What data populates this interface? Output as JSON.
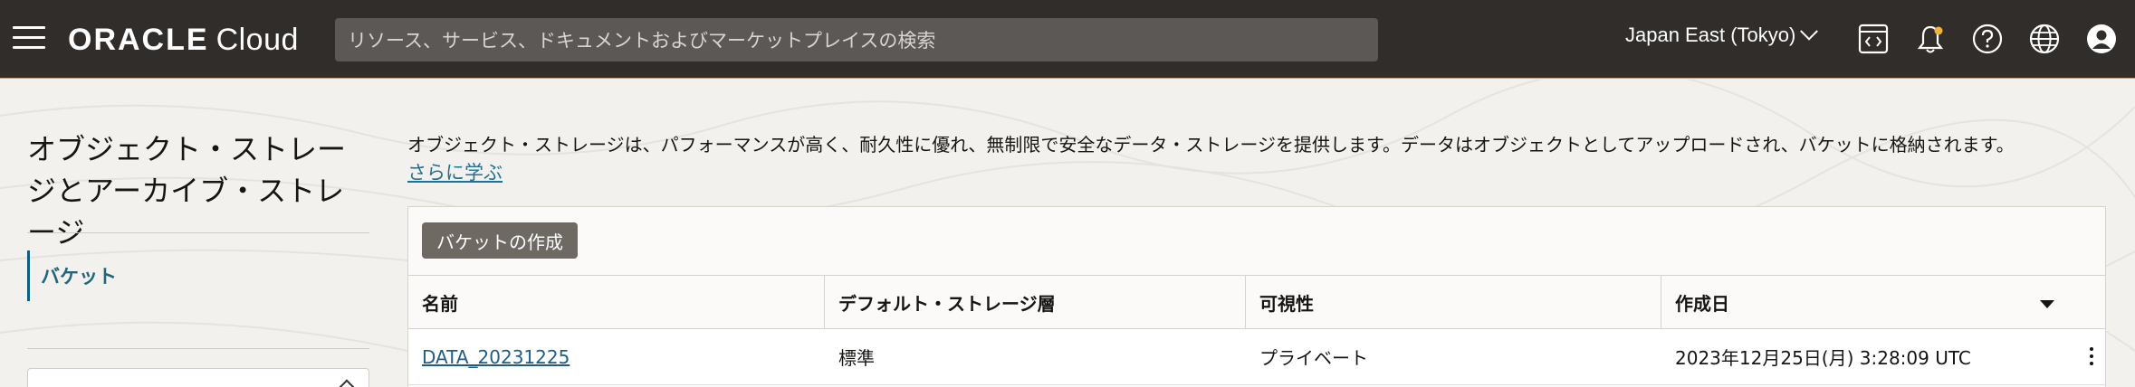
{
  "header": {
    "brand_main": "ORACLE",
    "brand_sub": "Cloud",
    "search_placeholder": "リソース、サービス、ドキュメントおよびマーケットプレイスの検索",
    "region": "Japan East (Tokyo)",
    "icons": [
      "menu-icon",
      "code-editor-icon",
      "notification-bell-icon",
      "help-icon",
      "language-globe-icon",
      "user-profile-icon"
    ],
    "notification_dot_color": "#f0b43c"
  },
  "sidebar": {
    "title": "オブジェクト・ストレージとアーカイブ・ストレージ",
    "items": [
      {
        "label": "バケット",
        "active": true
      }
    ]
  },
  "main": {
    "description": "オブジェクト・ストレージは、パフォーマンスが高く、耐久性に優れ、無制限で安全なデータ・ストレージを提供します。データはオブジェクトとしてアップロードされ、バケットに格納されます。",
    "learn_more": "さらに学ぶ",
    "create_button": "バケットの作成",
    "table": {
      "columns": [
        "名前",
        "デフォルト・ストレージ層",
        "可視性",
        "作成日"
      ],
      "sorted_column": "作成日",
      "sort_direction": "descending",
      "rows": [
        {
          "name": "DATA_20231225",
          "tier": "標準",
          "visibility": "プライベート",
          "created": "2023年12月25日(月) 3:28:09 UTC"
        }
      ]
    }
  },
  "colors": {
    "header_bg": "#312d2a",
    "accent_link": "#227094",
    "button_bg": "#6f6964"
  }
}
